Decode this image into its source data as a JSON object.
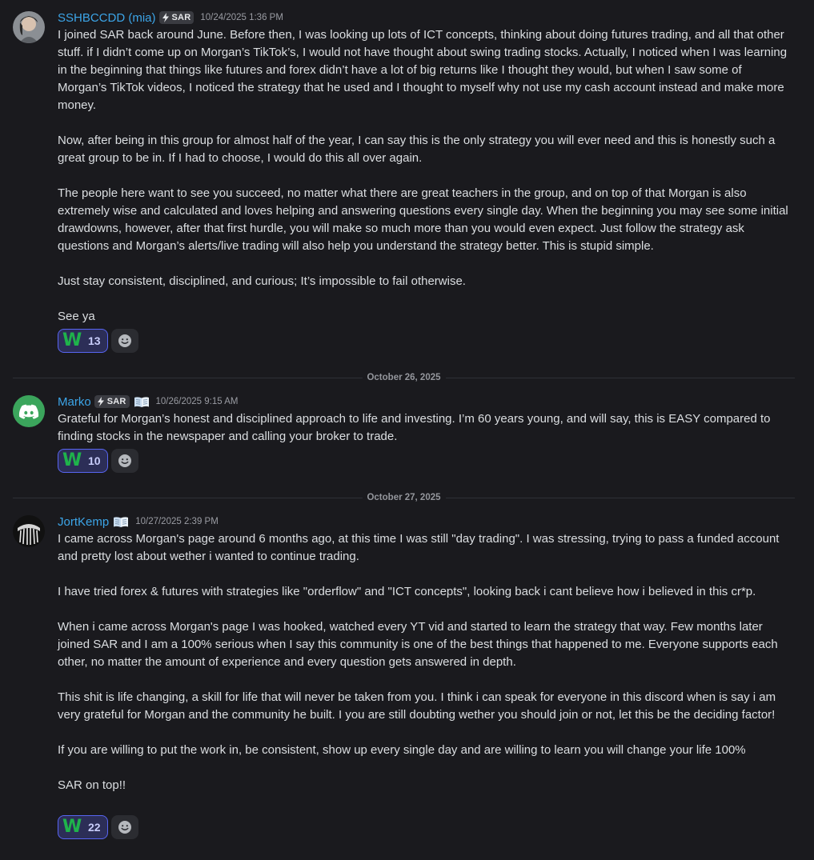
{
  "messages": [
    {
      "username": "SSHBCCDD (mia)",
      "tag": "SAR",
      "timestamp": "10/24/2025 1:36 PM",
      "paragraphs": [
        "I joined SAR back around June. Before then, I was looking up lots of ICT concepts, thinking about doing futures trading, and all that other stuff. if I didn’t come up on Morgan’s TikTok’s, I would not have thought about swing trading stocks. Actually, I noticed when I was learning in the beginning that things like futures and forex didn’t have a lot of big returns like I thought they would, but  when I saw some of Morgan’s TikTok videos, I noticed the strategy that he used and I thought to myself why not use my cash account instead and make more money.",
        "Now, after being in this group for almost half of the year, I can say this is the only strategy you will ever need and this is honestly such a great group to be in. If I had to choose, I would do this all over again.",
        "The people here want to see you succeed, no matter what there are great teachers in the group, and on top of that Morgan is also extremely wise and calculated and loves helping and answering questions every single day. When the beginning you may see some initial drawdowns, however, after that first hurdle, you will make so much more than you would even expect. Just follow the strategy ask questions and Morgan’s alerts/live trading will also help you understand the strategy better. This is stupid simple.",
        "Just stay consistent, disciplined, and curious; It’s impossible to fail otherwise.",
        "See ya"
      ],
      "reaction": {
        "emoji": "W",
        "count": "13"
      }
    },
    {
      "username": "Marko",
      "tag": "SAR",
      "timestamp": "10/26/2025 9:15 AM",
      "paragraphs": [
        "Grateful for Morgan’s honest and disciplined approach to life and investing. I’m 60 years young, and will say, this is EASY compared to finding stocks in the newspaper and calling your broker to trade."
      ],
      "reaction": {
        "emoji": "W",
        "count": "10"
      }
    },
    {
      "username": "JortKemp",
      "timestamp": "10/27/2025 2:39 PM",
      "paragraphs": [
        "I came across Morgan's page around 6 months ago, at this time I was still \"day trading\". I was stressing, trying to pass a funded account and pretty lost about wether i wanted to continue trading.",
        "I have tried forex & futures with strategies like \"orderflow\" and \"ICT concepts\", looking back i cant believe how i believed in this cr*p.",
        "When i came across Morgan's page I was hooked,  watched every YT vid and started to learn the strategy that way. Few months later joined SAR and I am a 100% serious when I say this community is one of the best things that happened to me. Everyone supports each other, no matter the amount of experience and every question gets answered in depth.",
        "This shit is life changing, a skill for life that will never be taken from you. I think i can speak for everyone in this discord when is say i am very grateful for Morgan and the community he built. I you are still doubting wether you should join or not, let this be the deciding factor!",
        "If you are willing to put the work in, be consistent, show up every single day and are willing to learn you will change your life 100%",
        "SAR on top!!"
      ],
      "reaction": {
        "emoji": "W",
        "count": "22"
      }
    }
  ],
  "dividers": [
    "October 26, 2025",
    "October 27, 2025"
  ],
  "colors": {
    "background": "#1a1a1e",
    "username": "#3ca5e8",
    "text": "#dbdee1",
    "reaction_border": "#5865f2",
    "w_emoji": "#1fb34b",
    "discord_avatar": "#3ba55c"
  },
  "icons": {
    "tag_icon": "lightning-bolt-icon",
    "badge_icon": "open-book-icon",
    "add_reaction_icon": "smiley-face-icon",
    "default_avatar_icon": "discord-logo-icon"
  }
}
